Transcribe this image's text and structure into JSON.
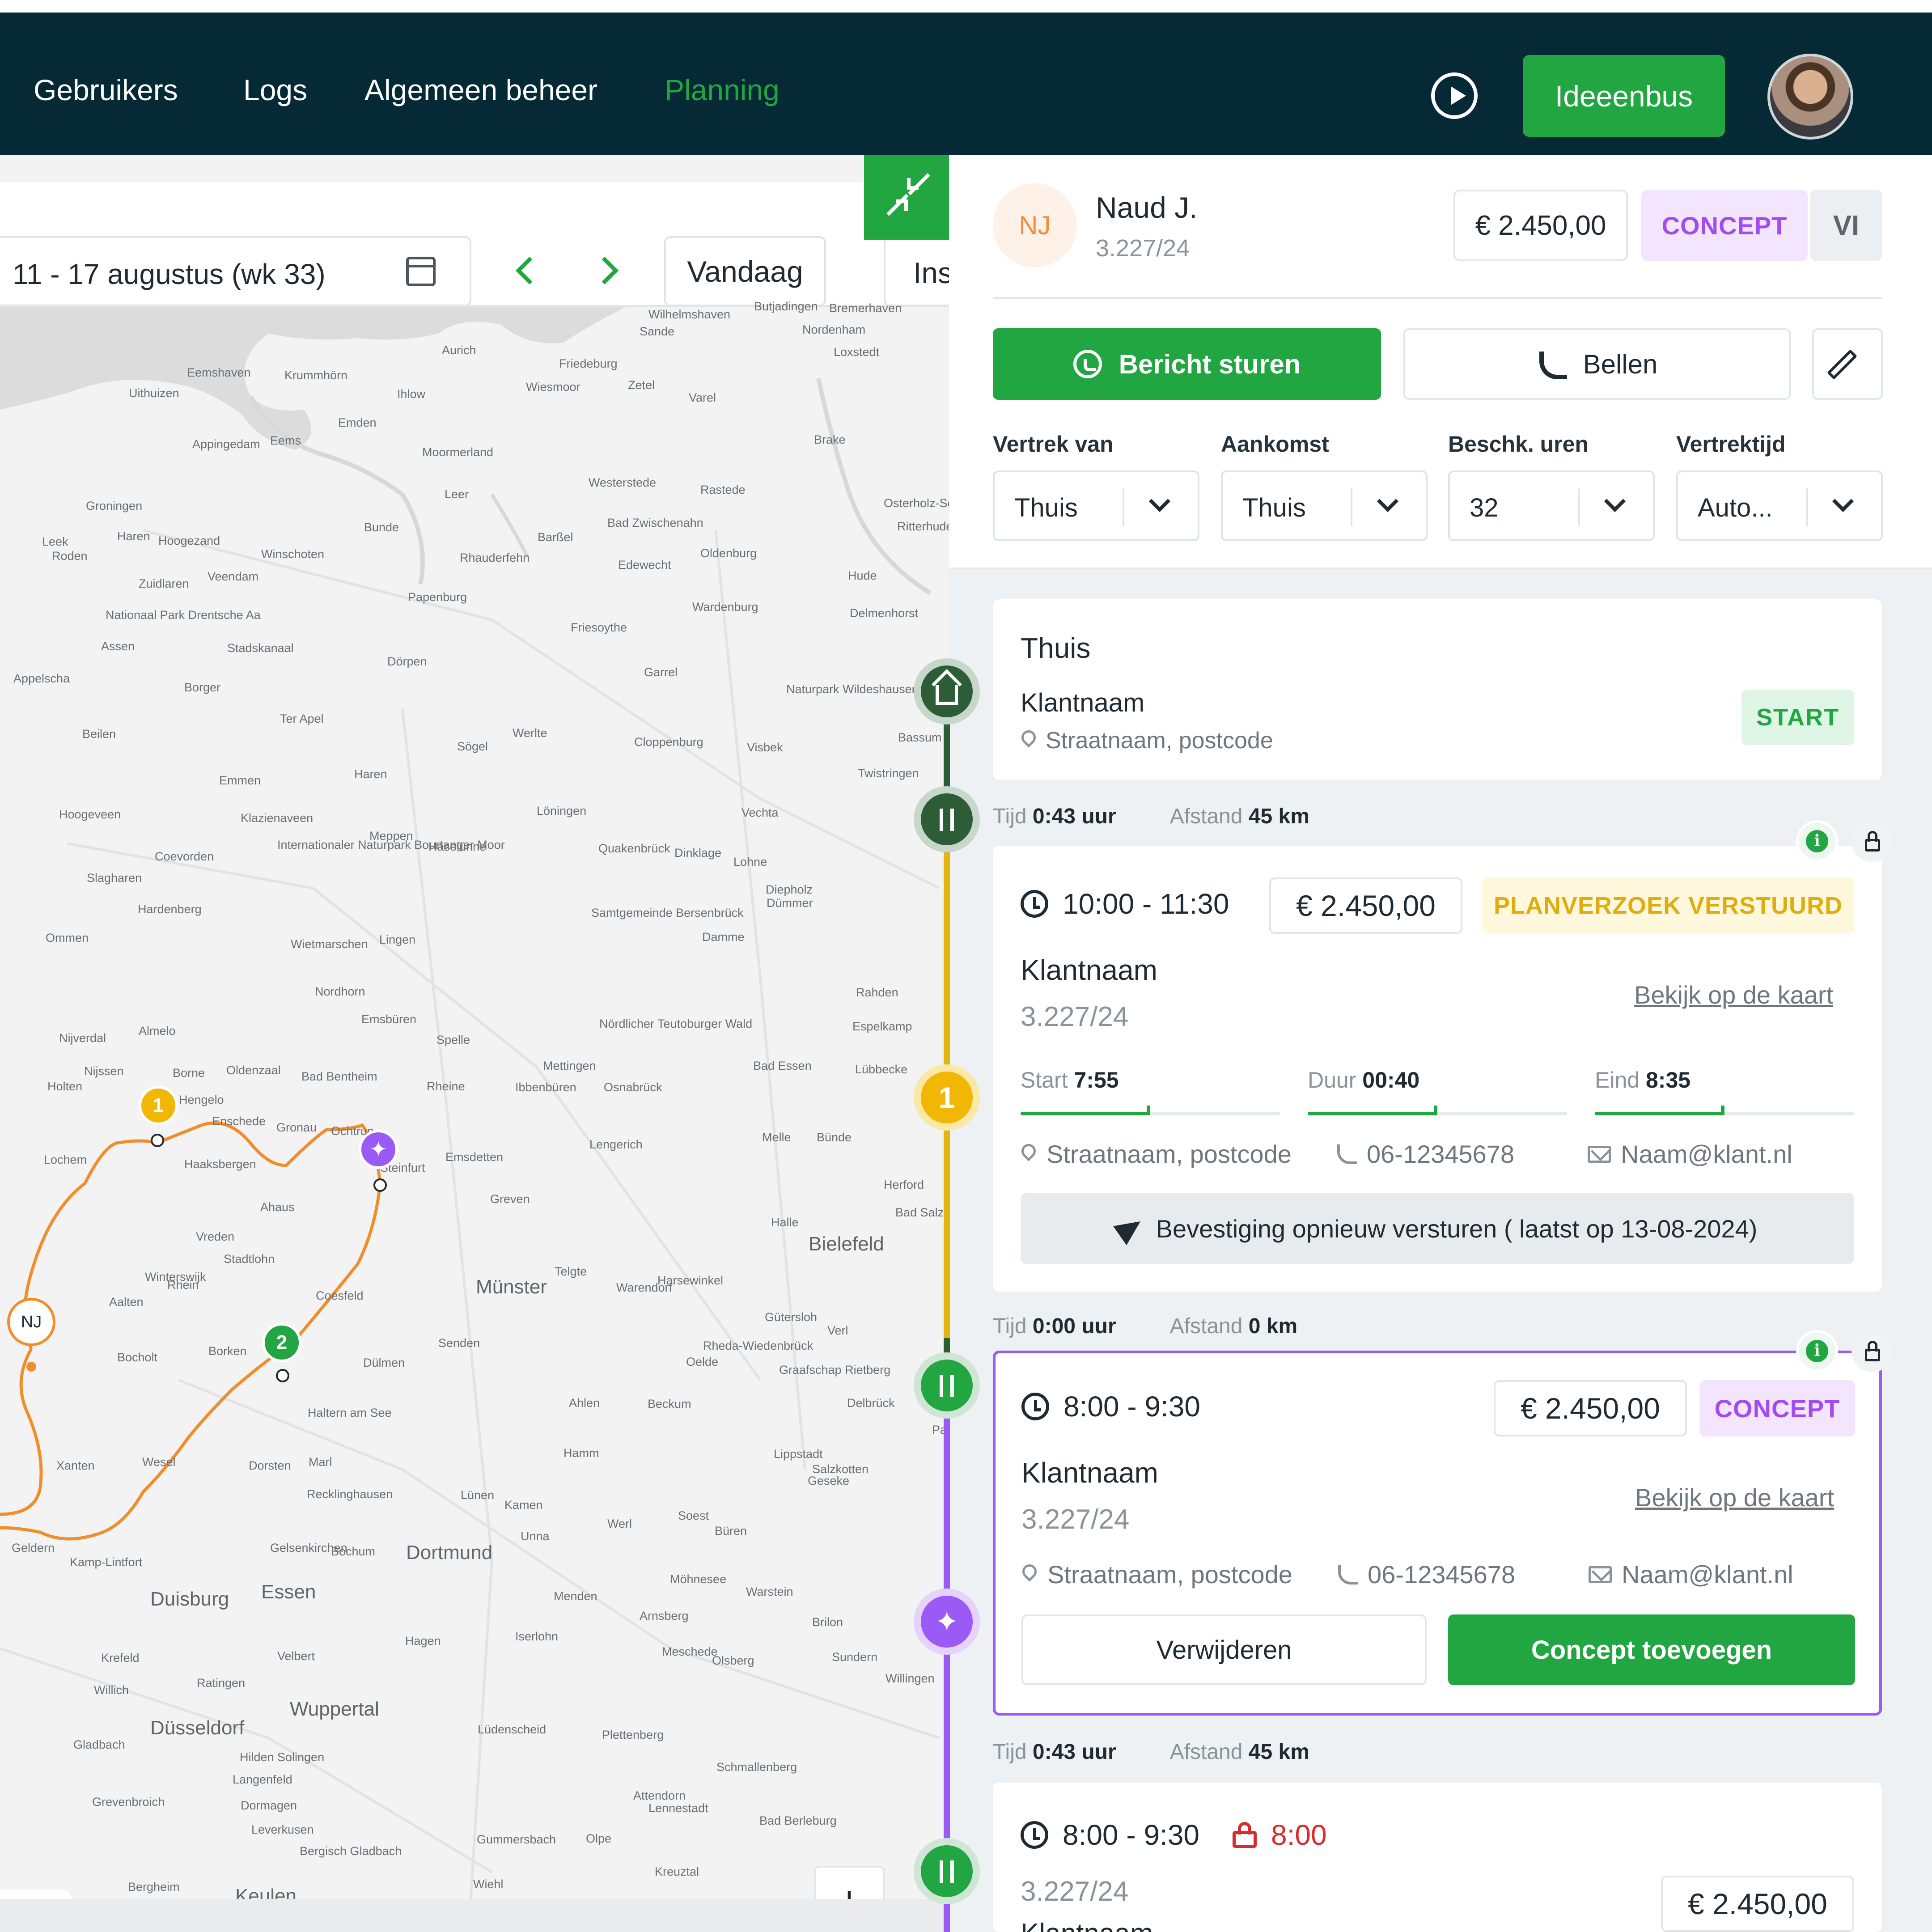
{
  "nav": {
    "items": [
      "Gebruikers",
      "Logs",
      "Algemeen beheer",
      "Planning"
    ],
    "active": "Planning",
    "idea_button": "Ideeenbus",
    "play_icon": "play-circle-icon"
  },
  "map_toolbar": {
    "week_range": "11 - 17 augustus (wk 33)",
    "today_button": "Vandaag",
    "ins_button": "Ins"
  },
  "map": {
    "towns": [
      "Wilhelmshaven",
      "Sande",
      "Butjadingen",
      "Bremerhaven",
      "Nordenham",
      "Aurich",
      "Friedeburg",
      "Loxstedt",
      "Eemshaven",
      "Krummhörn",
      "Uithuizen",
      "Ihlow",
      "Wiesmoor",
      "Zetel",
      "Varel",
      "Emden",
      "Appingedam",
      "Eems",
      "Moormerland",
      "Brake",
      "Leer",
      "Westerstede",
      "Rastede",
      "Osterholz-Sc",
      "Groningen",
      "Haren",
      "Hoogezand",
      "Leek",
      "Roden",
      "Winschoten",
      "Bunde",
      "Barßel",
      "Bad Zwischenahn",
      "Oldenburg",
      "Ritterhude",
      "Rhauderfehn",
      "Edewecht",
      "Hude",
      "Zuidlaren",
      "Veendam",
      "Papenburg",
      "Wardenburg",
      "Delmenhorst",
      "Nationaal Park Drentsche Aa",
      "Assen",
      "Friesoythe",
      "Stadskanaal",
      "Dörpen",
      "Garrel",
      "Appelscha",
      "Borger",
      "Naturpark Wildeshauser Geest",
      "Ter Apel",
      "Beilen",
      "Sögel",
      "Werlte",
      "Cloppenburg",
      "Visbek",
      "Bassum",
      "Emmen",
      "Haren",
      "Twistringen",
      "Hoogeveen",
      "Klazienaveen",
      "Löningen",
      "Vechta",
      "Meppen",
      "Haselünne",
      "Quakenbrück",
      "Dinklage",
      "Lohne",
      "Coevorden",
      "Internationaler Naturpark Bourtanger Moor",
      "Slagharen",
      "Diepholz",
      "Dümmer",
      "Hardenberg",
      "Samtgemeinde Bersenbrück",
      "Damme",
      "Ommen",
      "Wietmarschen",
      "Lingen",
      "Nordhorn",
      "Rahden",
      "Almelo",
      "Emsbüren",
      "Spelle",
      "Nördlicher Teutoburger Wald",
      "Espelkamp",
      "Nijverdal",
      "Nijssen",
      "Borne",
      "Oldenzaal",
      "Bad Bentheim",
      "Mettingen",
      "Bad Essen",
      "Lübbecke",
      "Holten",
      "Hengelo",
      "Rheine",
      "Ibbenbüren",
      "Osnabrück",
      "Enschede",
      "Gronau",
      "Ochtrup",
      "Lochem",
      "Haaksbergen",
      "Steinfurt",
      "Emsdetten",
      "Lengerich",
      "Melle",
      "Bünde",
      "Herford",
      "Greven",
      "Vreden",
      "Stadtlohn",
      "Ahaus",
      "Halle",
      "Bad Salzuflen",
      "Bielefeld",
      "Winterswijk",
      "Telgte",
      "Münster",
      "Coesfeld",
      "Harsewinkel",
      "Warendorf",
      "Aalten",
      "Gütersloh",
      "Verl",
      "Bocholt",
      "Borken",
      "Senden",
      "Rheda-Wiedenbrück",
      "Oelde",
      "Dülmen",
      "Graafschap Rietberg",
      "Delbrück",
      "Ahlen",
      "Beckum",
      "Haltern am See",
      "Paderborn",
      "Xanten",
      "Wesel",
      "Dorsten",
      "Marl",
      "Hamm",
      "Lippstadt",
      "Salzkotten",
      "Geseke",
      "Recklinghausen",
      "Lünen",
      "Kamen",
      "Werl",
      "Soest",
      "Büren",
      "Geldern",
      "Kamp-Lintfort",
      "Gelsenkirchen",
      "Bochum",
      "Unna",
      "Dortmund",
      "Duisburg",
      "Essen",
      "Möhnesee",
      "Menden",
      "Warstein",
      "Krefeld",
      "Velbert",
      "Arnsberg",
      "Brilon",
      "Hagen",
      "Iserlohn",
      "Meschede",
      "Olsberg",
      "Sundern",
      "Willich",
      "Ratingen",
      "Wuppertal",
      "Willingen",
      "Düsseldorf",
      "Lüdenscheid",
      "Plettenberg",
      "Gladbach",
      "Hilden",
      "Solingen",
      "Schmallenberg",
      "Langenfeld",
      "Attendorn",
      "Lennestadt",
      "Grevenbroich",
      "Dormagen",
      "Bad Berleburg",
      "Leverkusen",
      "Gummersbach",
      "Olpe",
      "Bergisch Gladbach",
      "Kreuztal",
      "Bergheim",
      "Keulen",
      "Wiehl",
      "Rhein"
    ],
    "markers": [
      {
        "label": "1"
      },
      {
        "label": "2"
      },
      {
        "label": "NJ"
      }
    ],
    "zoom_in": "+",
    "zoom_out": "−"
  },
  "employee": {
    "initials": "NJ",
    "name": "Naud J.",
    "code": "3.227/24",
    "amount": "€ 2.450,00",
    "status": "CONCEPT",
    "extra": "VI",
    "message_button": "Bericht sturen",
    "call_button": "Bellen"
  },
  "selects": [
    {
      "label": "Vertrek van",
      "value": "Thuis"
    },
    {
      "label": "Aankomst",
      "value": "Thuis"
    },
    {
      "label": "Beschk. uren",
      "value": "32"
    },
    {
      "label": "Vertrektijd",
      "value": "Auto..."
    }
  ],
  "start_card": {
    "title": "Thuis",
    "client": "Klantnaam",
    "address": "Straatnaam, postcode",
    "badge": "START"
  },
  "travel": [
    {
      "time_label": "Tijd",
      "time": "0:43 uur",
      "dist_label": "Afstand",
      "dist": "45 km"
    },
    {
      "time_label": "Tijd",
      "time": "0:00 uur",
      "dist_label": "Afstand",
      "dist": "0 km"
    },
    {
      "time_label": "Tijd",
      "time": "0:43 uur",
      "dist_label": "Afstand",
      "dist": "45 km"
    }
  ],
  "card1": {
    "time": "10:00 - 11:30",
    "amount": "€ 2.450,00",
    "status": "PLANVERZOEK VERSTUURD",
    "client": "Klantnaam",
    "code": "3.227/24",
    "map_link": "Bekijk op de kaart",
    "start_label": "Start",
    "start": "7:55",
    "duur_label": "Duur",
    "duur": "00:40",
    "eind_label": "Eind",
    "eind": "8:35",
    "progress": [
      0.5,
      0.5,
      0.5
    ],
    "address": "Straatnaam, postcode",
    "phone": "06-12345678",
    "email": "Naam@klant.nl",
    "resend": "Bevestiging opnieuw versturen ( laatst op 13-08-2024)"
  },
  "card2": {
    "time": "8:00 - 9:30",
    "amount": "€ 2.450,00",
    "status": "CONCEPT",
    "client": "Klantnaam",
    "code": "3.227/24",
    "map_link": "Bekijk op de kaart",
    "address": "Straatnaam, postcode",
    "phone": "06-12345678",
    "email": "Naam@klant.nl",
    "delete": "Verwijderen",
    "add": "Concept toevoegen"
  },
  "card3": {
    "time": "8:00 - 9:30",
    "locked_time": "8:00",
    "code": "3.227/24",
    "amount": "€ 2.450,00",
    "client": "Klantnaam"
  },
  "timeline_nodes": [
    {
      "type": "home",
      "icon": "home-icon"
    },
    {
      "type": "travel",
      "icon": "swap-icon"
    },
    {
      "type": "stop",
      "label": "1"
    },
    {
      "type": "travel",
      "icon": "swap-icon"
    },
    {
      "type": "concept",
      "icon": "sparkle-icon"
    },
    {
      "type": "travel",
      "icon": "swap-icon"
    }
  ],
  "colors": {
    "brand_green": "#22a642",
    "nav_bg": "#062a35",
    "route_orange": "#f08e2c",
    "stop_yellow": "#f2b705",
    "concept_purple": "#9b59f5",
    "timeline_green": "#2d5d36"
  }
}
